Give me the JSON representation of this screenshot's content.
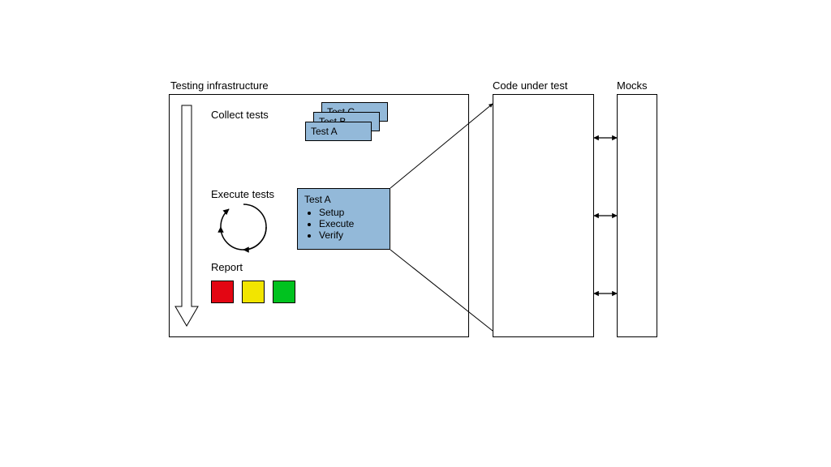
{
  "labels": {
    "testing_infra": "Testing infrastructure",
    "code_under_test": "Code under test",
    "mocks": "Mocks",
    "collect_tests": "Collect tests",
    "execute_tests": "Execute tests",
    "report": "Report"
  },
  "test_cards": {
    "c": "Test C",
    "b": "Test B",
    "a": "Test A"
  },
  "detail": {
    "title": "Test A",
    "steps": {
      "setup": "Setup",
      "execute": "Execute",
      "verify": "Verify"
    }
  },
  "colors": {
    "swatch_red": "#e30613",
    "swatch_yellow": "#f2e500",
    "swatch_green": "#00c21f",
    "card_bg": "#93b9d9"
  }
}
